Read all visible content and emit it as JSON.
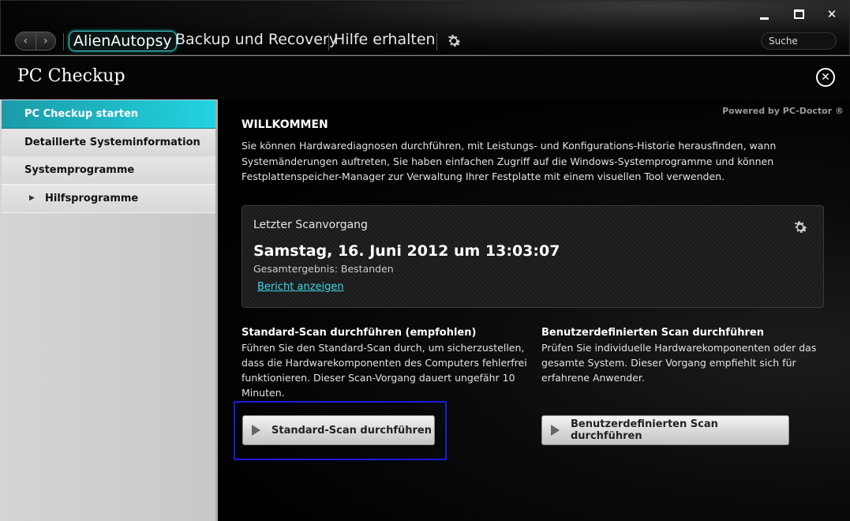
{
  "topbar": {
    "tabs": [
      "AlienAutopsy",
      "Backup und Recovery",
      "Hilfe erhalten"
    ],
    "search_placeholder": "Suche"
  },
  "header": {
    "title": "PC Checkup"
  },
  "sidebar": {
    "items": [
      {
        "label": "PC Checkup starten"
      },
      {
        "label": "Detaillerte Systeminformation"
      },
      {
        "label": "Systemprogramme"
      },
      {
        "label": "Hilfsprogramme"
      }
    ]
  },
  "main": {
    "powered_by": "Powered by PC-Doctor ®",
    "welcome_title": "WILLKOMMEN",
    "welcome_text": "Sie können Hardwarediagnosen durchführen, mit Leistungs- und Konfigurations-Historie herausfinden, wann Systemänderungen auftreten, Sie haben einfachen Zugriff auf die Windows-Systemprogramme und können Festplattenspeicher-Manager zur Verwaltung Ihrer Festplatte mit einem visuellen Tool verwenden.",
    "last_scan": {
      "label": "Letzter Scanvorgang",
      "date": "Samstag, 16. Juni 2012 um 13:03:07",
      "result": "Gesamtergebnis: Bestanden",
      "report_link": "Bericht anzeigen"
    },
    "standard": {
      "heading": "Standard-Scan durchführen (empfohlen)",
      "text": "Führen Sie den Standard-Scan durch, um sicherzustellen, dass die Hardwarekomponenten des Computers fehlerfrei funktionieren. Dieser Scan-Vorgang dauert ungefähr 10 Minuten.",
      "button": "Standard-Scan durchführen"
    },
    "custom": {
      "heading": "Benutzerdefinierten Scan durchführen",
      "text": "Prüfen Sie individuelle Hardwarekomponenten oder das gesamte System. Dieser Vorgang empfiehlt sich für erfahrene Anwender.",
      "button": "Benutzerdefinierten Scan durchführen"
    }
  },
  "colors": {
    "accent": "#22d4e0",
    "highlight_box": "#1a1ae6"
  }
}
